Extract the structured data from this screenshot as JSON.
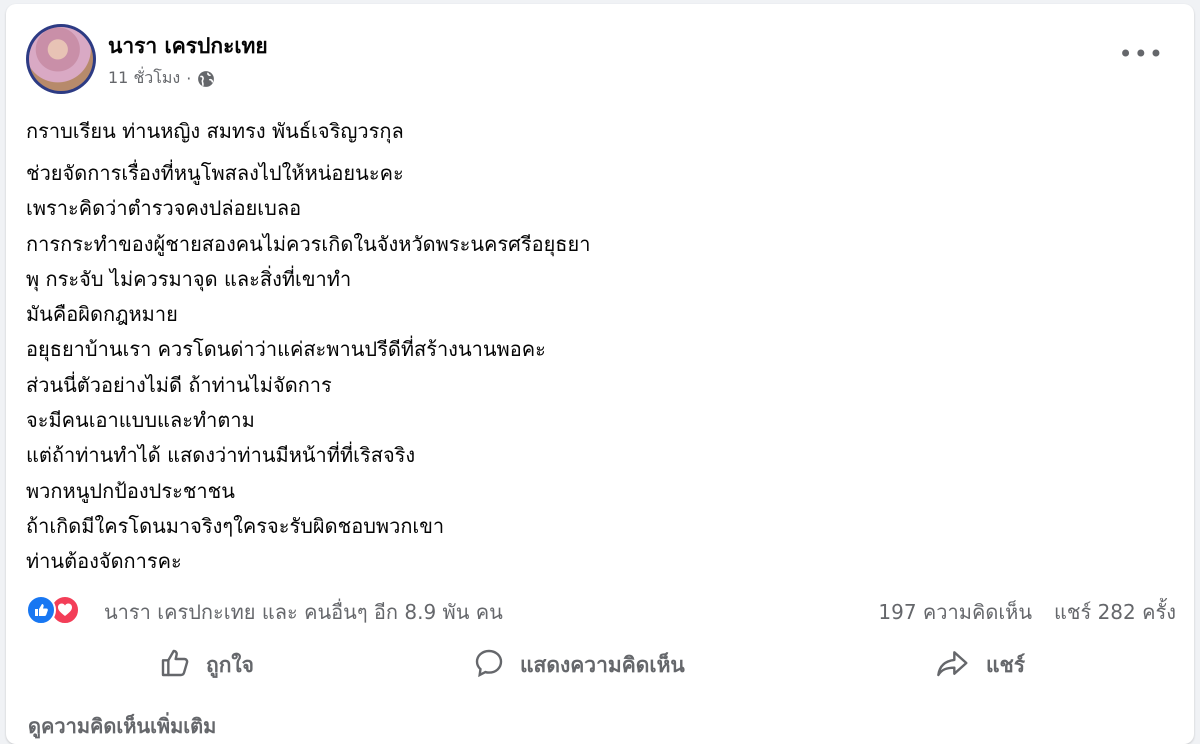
{
  "post": {
    "author": "นารา เครปกะเทย",
    "time": "11 ชั่วโมง",
    "separator": "·",
    "privacy_icon": "globe-icon",
    "more_label": "•••",
    "greeting": "กราบเรียน ท่านหญิง สมทรง พันธ์เจริญวรกุล",
    "lines": [
      "ช่วยจัดการเรื่องที่หนูโพสลงไปให้หน่อยนะคะ",
      "เพราะคิดว่าตำรวจคงปล่อยเบลอ",
      "การกระทำของผู้ชายสองคนไม่ควรเกิดในจังหวัดพระนครศรีอยุธยา",
      "พุ กระจับ ไม่ควรมาจุด และสิ่งที่เขาทำ",
      "มันคือผิดกฎหมาย",
      "อยุธยาบ้านเรา ควรโดนด่าว่าแค่สะพานปรีดีที่สร้างนานพอคะ",
      "ส่วนนี่ตัวอย่างไม่ดี ถ้าท่านไม่จัดการ",
      "จะมีคนเอาแบบและทำตาม",
      "แต่ถ้าท่านทำได้ แสดงว่าท่านมีหน้าที่ที่เริสจริง",
      "พวกหนูปกป้องประชาชน",
      "ถ้าเกิดมีใครโดนมาจริงๆใครจะรับผิดชอบพวกเขา",
      "ท่านต้องจัดการคะ"
    ]
  },
  "reactions": {
    "summary": "นารา เครปกะเทย และ คนอื่นๆ อีก 8.9 พัน คน",
    "comments": "197 ความคิดเห็น",
    "shares": "แชร์ 282 ครั้ง"
  },
  "actions": {
    "like": "ถูกใจ",
    "comment": "แสดงความคิดเห็น",
    "share": "แชร์"
  },
  "more_comments": "ดูความคิดเห็นเพิ่มเติม",
  "colors": {
    "like_blue": "#1877f2",
    "love_red": "#f33e58",
    "secondary_text": "#65676b"
  }
}
